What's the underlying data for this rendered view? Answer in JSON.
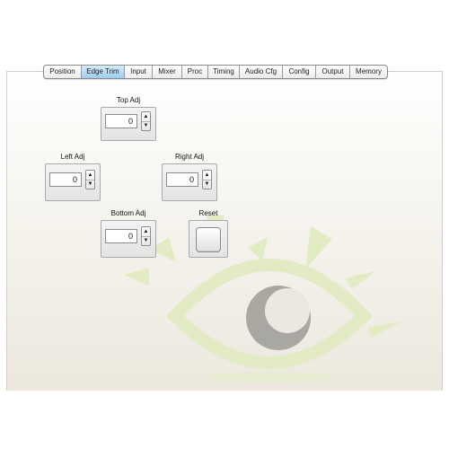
{
  "tabs": [
    {
      "label": "Position",
      "active": false
    },
    {
      "label": "Edge Trim",
      "active": true
    },
    {
      "label": "Input",
      "active": false
    },
    {
      "label": "Mixer",
      "active": false
    },
    {
      "label": "Proc",
      "active": false
    },
    {
      "label": "Timing",
      "active": false
    },
    {
      "label": "Audio Cfg",
      "active": false
    },
    {
      "label": "Config",
      "active": false
    },
    {
      "label": "Output",
      "active": false
    },
    {
      "label": "Memory",
      "active": false
    }
  ],
  "controls": {
    "top_adj": {
      "label": "Top Adj",
      "value": "0"
    },
    "left_adj": {
      "label": "Left Adj",
      "value": "0"
    },
    "right_adj": {
      "label": "Right Adj",
      "value": "0"
    },
    "bottom_adj": {
      "label": "Bottom Adj",
      "value": "0"
    },
    "reset": {
      "label": "Reset"
    }
  },
  "icons": {
    "stepper_up": "▲",
    "stepper_down": "▼"
  },
  "colors": {
    "active_tab": "#a9d3f4",
    "logo_green": "#dfe9bd",
    "logo_iris": "#a5a39f"
  }
}
